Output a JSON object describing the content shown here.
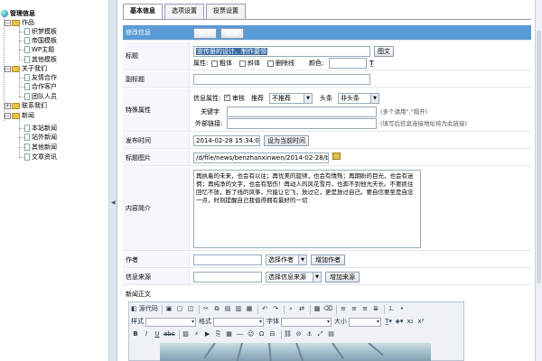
{
  "tree": {
    "root": "管理信息",
    "nodes": [
      {
        "label": "作品",
        "children": [
          "织梦模板",
          "帝国模板",
          "WP主题",
          "其他模板"
        ]
      },
      {
        "label": "关于我们",
        "children": [
          "友情合作",
          "合作客户",
          "团队人员"
        ]
      },
      {
        "label": "联系我们",
        "children": []
      },
      {
        "label": "新闻",
        "children": [
          "本站新闻",
          "站外新闻",
          "其他新闻",
          "文章资讯"
        ]
      }
    ]
  },
  "tabs": [
    "基本信息",
    "选项设置",
    "投票设置"
  ],
  "form": {
    "header_label": "修改信息",
    "submit_label": "提交",
    "reset_label": "重置",
    "title_label": "标题",
    "title_value": "宣传册的设计、制作要领",
    "title_button": "图文",
    "attr_label": "属性:",
    "bold_label": "粗体",
    "italic_label": "斜体",
    "strike_label": "删除线",
    "color_label": "颜色:",
    "subtitle_label": "副标题",
    "special_label": "特殊属性",
    "info_attr_label": "信息属性:",
    "audit_label": "审核",
    "recommend_label": "推荐",
    "recommend_value": "不推荐",
    "headline_label": "头条",
    "headline_value": "非头条",
    "keyword_label": "关键字",
    "keyword_hint": "(多个请用\",\"隔开)",
    "external_label": "外部链接:",
    "external_hint": "(填写后信息连接地址将为此链接)",
    "pubtime_label": "发布时间",
    "pubtime_value": "2014-02-28 15:34:01",
    "pubtime_button": "设为当前时间",
    "titleimg_label": "标题图片",
    "titleimg_value": "/d/file/news/benzhanxinwen/2014-02-28/bc",
    "intro_label": "内容简介",
    "intro_value": "再执着的未来，也会有以往；再优美的旋律，也会有情殇；再期盼的目光，也会有迷惘；再纯净的文字，也会有怒伤！再动人的风花雪月，也奔不到他亢天长。不要抓住回忆不放，断了线的风筝，只能让它飞，放过它，更是放过自己。要自信要至是自念一点，时刻提醒自己我值得拥有最好的一切",
    "author_label": "作者",
    "author_select": "选择作者",
    "author_button": "增加作者",
    "source_label": "信息来源",
    "source_select": "选择信息来源",
    "source_button": "增加来源",
    "content_label": "新闻正文"
  },
  "editor": {
    "source_label": "源代码",
    "style_label": "样式",
    "format_label": "格式",
    "font_label": "字体",
    "size_label": "大小"
  }
}
